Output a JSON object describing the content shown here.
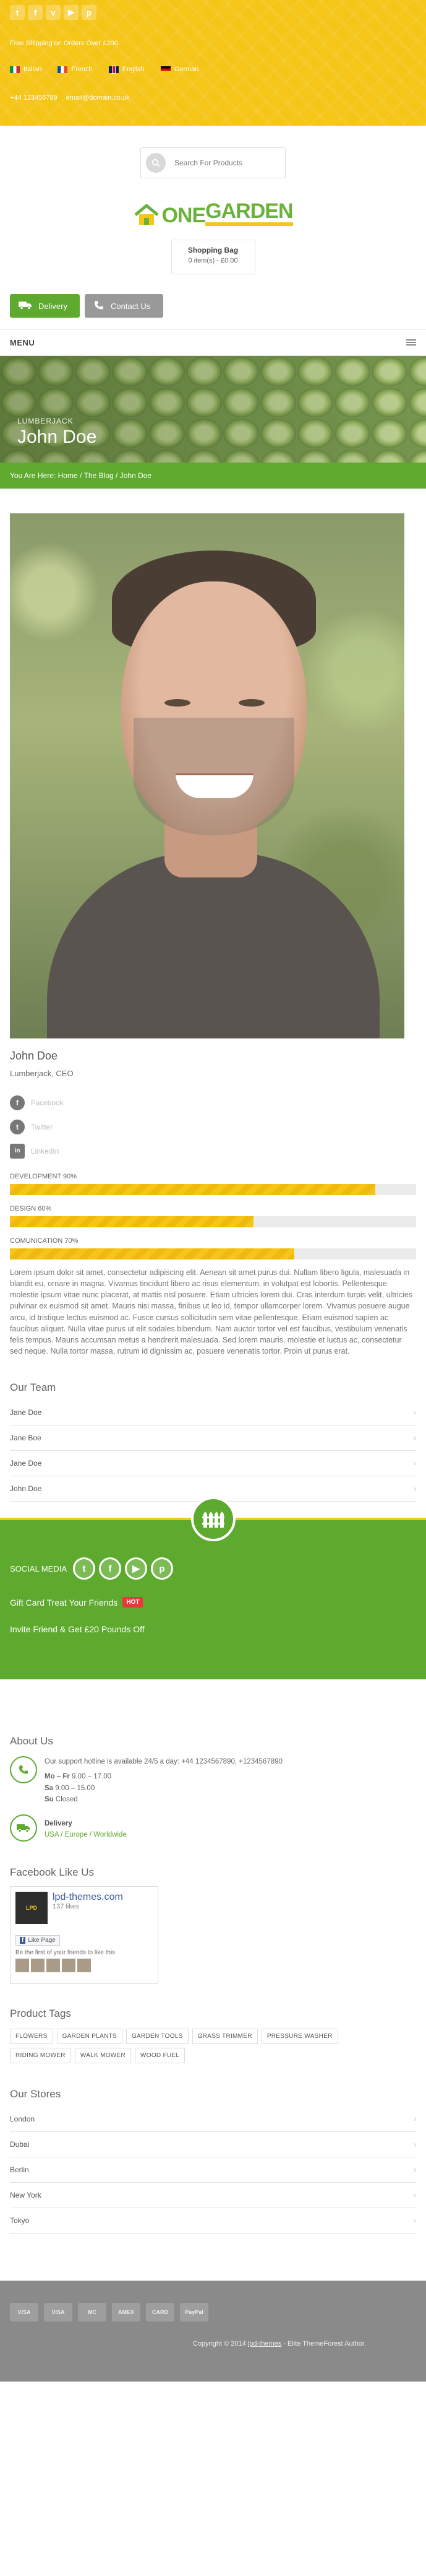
{
  "topbar": {
    "social_icons": [
      "twitter-icon",
      "facebook-icon",
      "vimeo-icon",
      "youtube-icon",
      "pinterest-icon"
    ],
    "social_glyphs": [
      "t",
      "f",
      "v",
      "▶",
      "p"
    ],
    "shipping": "Free Shipping on Orders Over £200",
    "languages": [
      "Italian",
      "French",
      "English",
      "German"
    ],
    "phone": "+44 123456789",
    "email": "email@domain.co.uk"
  },
  "search": {
    "placeholder": "Search For Products"
  },
  "logo": {
    "one": "ONE",
    "garden": "GARDEN"
  },
  "cart": {
    "title": "Shopping Bag",
    "summary": "0 item(s) - £0.00"
  },
  "buttons": {
    "delivery": "Delivery",
    "contact": "Contact Us"
  },
  "menu": {
    "label": "MENU"
  },
  "hero": {
    "subtitle": "LUMBERJACK",
    "title": "John Doe"
  },
  "breadcrumb": {
    "prefix": "You Are Here:",
    "home": "Home",
    "sep1": "/",
    "blog": "The Blog",
    "sep2": "/",
    "current": "John Doe"
  },
  "profile": {
    "name": "John Doe",
    "role": "Lumberjack, CEO",
    "socials": [
      {
        "label": "Facebook",
        "icon": "facebook-icon",
        "glyph": "f"
      },
      {
        "label": "Twitter",
        "icon": "twitter-icon",
        "glyph": "t"
      },
      {
        "label": "LinkedIn",
        "icon": "linkedin-icon",
        "glyph": "in"
      }
    ],
    "skills": [
      {
        "label": "DEVELOPMENT 90%",
        "value": 0.9
      },
      {
        "label": "DESIGN 60%",
        "value": 0.6
      },
      {
        "label": "COMUNICATION 70%",
        "value": 0.7
      }
    ],
    "bio": "Lorem ipsum dolor sit amet, consectetur adipiscing elit. Aenean sit amet purus dui. Nullam libero ligula, malesuada in blandit eu, ornare in magna. Vivamus tincidunt libero ac risus elementum, in volutpat est lobortis. Pellentesque molestie ipsum vitae nunc placerat, at mattis nisl posuere. Etiam ultricies lorem dui. Cras interdum turpis velit, ultricies pulvinar ex euismod sit amet. Mauris nisi massa, finibus ut leo id, tempor ullamcorper lorem. Vivamus posuere augue arcu, id tristique lectus euismod ac. Fusce cursus sollicitudin sem vitae pellentesque. Etiam euismod sapien ac faucibus aliquet. Nulla vitae purus ut elit sodales bibendum. Nam auctor tortor vel est faucibus, vestibulum venenatis felis tempus. Mauris accumsan metus a hendrerit malesuada. Sed lorem mauris, molestie et luctus ac, consectetur sed neque. Nulla tortor massa, rutrum id dignissim ac, posuere venenatis tortor. Proin ut purus erat."
  },
  "team": {
    "title": "Our Team",
    "members": [
      "Jane Doe",
      "Jane Boe",
      "Jane Doe",
      "John Doe"
    ]
  },
  "footer_band": {
    "social_label": "SOCIAL MEDIA",
    "social_glyphs": [
      "t",
      "f",
      "▶",
      "p"
    ],
    "gift": "Gift Card Treat Your Friends",
    "hot": "HOT",
    "invite": "Invite Friend & Get £20 Pounds Off"
  },
  "about": {
    "title": "About Us",
    "support": "Our support hotline is available 24/5 a day: +44 1234567890, +1234567890",
    "hours": [
      {
        "day": "Mo – Fr",
        "time": "9.00 – 17.00"
      },
      {
        "day": "Sa",
        "time": "9.00 – 15.00"
      },
      {
        "day": "Su",
        "time": "Closed"
      }
    ],
    "delivery_title": "Delivery",
    "delivery_regions": "USA / Europe / Worldwide"
  },
  "facebook": {
    "title": "Facebook Like Us",
    "page_name": "lpd-themes.com",
    "likes": "137 likes",
    "like_button": "Like Page",
    "friends_text": "Be the first of your friends to like this"
  },
  "tags": {
    "title": "Product Tags",
    "items": [
      "FLOWERS",
      "GARDEN PLANTS",
      "GARDEN TOOLS",
      "GRASS TRIMMER",
      "PRESSURE WASHER",
      "RIDING MOWER",
      "WALK MOWER",
      "WOOD FUEL"
    ]
  },
  "stores": {
    "title": "Our Stores",
    "items": [
      "London",
      "Dubai",
      "Berlin",
      "New York",
      "Tokyo"
    ]
  },
  "payments": [
    "VISA",
    "VISA",
    "MC",
    "AMEX",
    "CARD",
    "PayPal"
  ],
  "copyright": {
    "text": "Copyright © 2014",
    "link": "lpd-themes",
    "suffix": "- Elite ThemeForest Author."
  }
}
